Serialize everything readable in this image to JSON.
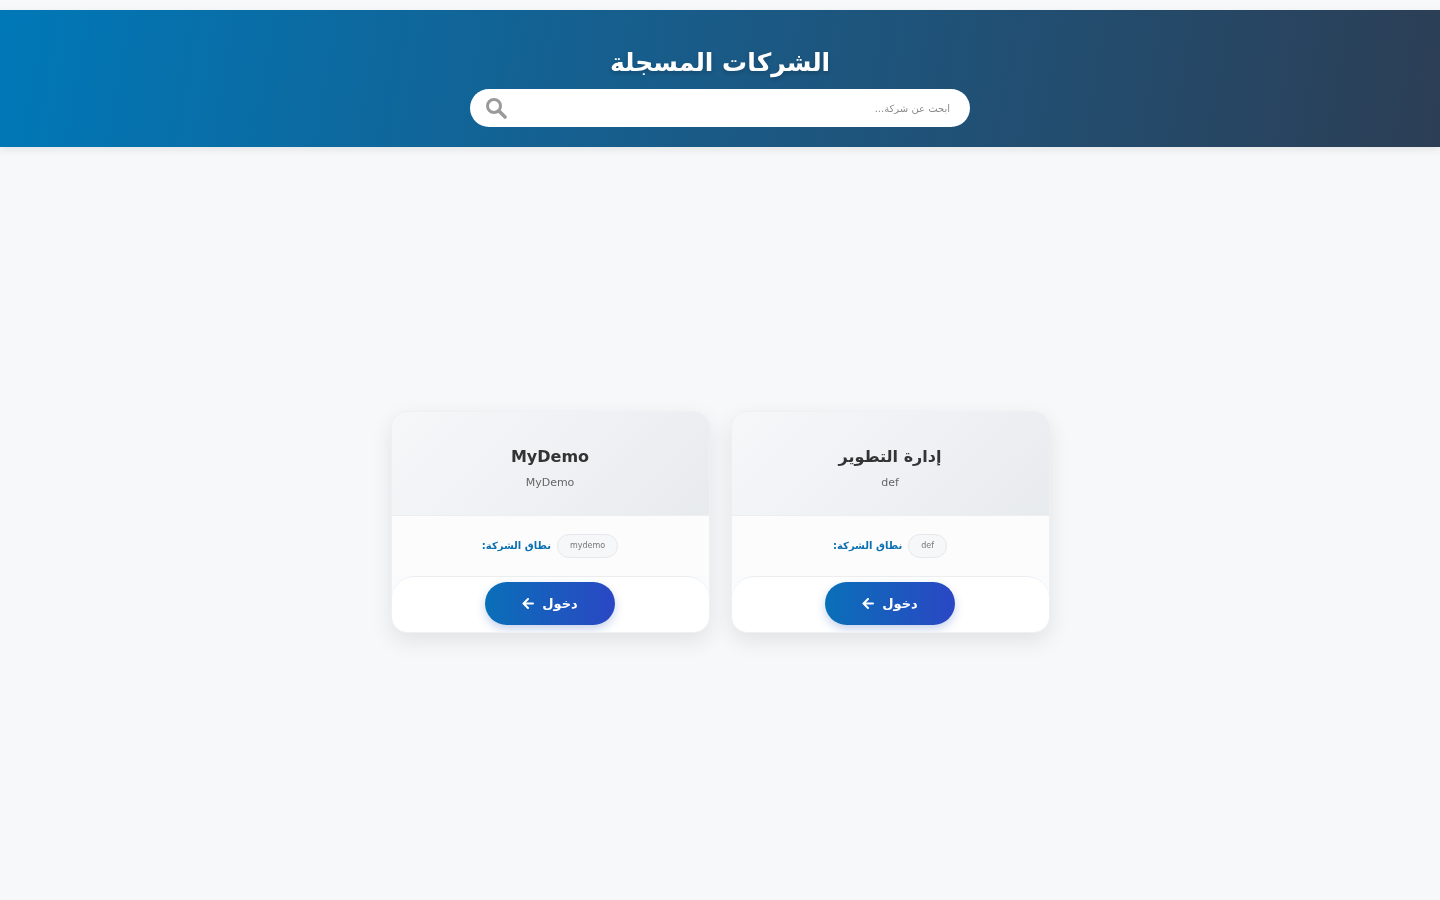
{
  "header": {
    "title": "الشركات المسجلة",
    "search": {
      "placeholder": "ابحث عن شركة..."
    }
  },
  "companies": [
    {
      "name": "إدارة التطوير",
      "subtitle": "def",
      "domain_label": "نطاق الشركة:",
      "domain": "def",
      "button": "دخول"
    },
    {
      "name": "MyDemo",
      "subtitle": "MyDemo",
      "domain_label": "نطاق الشركة:",
      "domain": "mydemo",
      "button": "دخول"
    }
  ]
}
